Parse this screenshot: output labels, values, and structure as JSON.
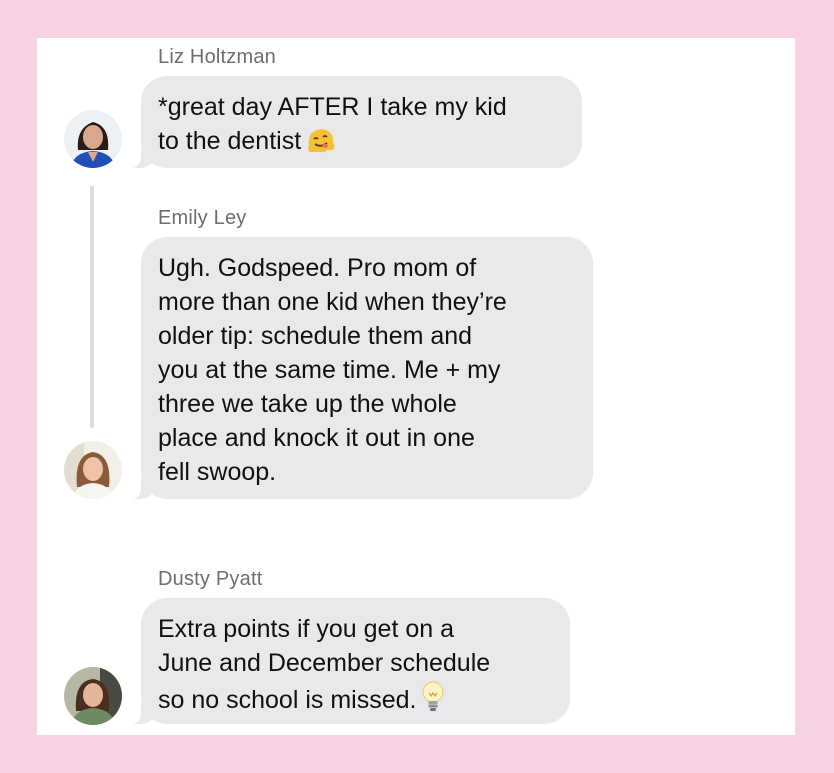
{
  "messages": [
    {
      "sender": "Liz Holtzman",
      "text": "*great day AFTER I take my kid\nto the dentist",
      "trailing_icon": "melting-face-emoji-icon",
      "avatar": "avatar-liz-holtzman"
    },
    {
      "sender": "Emily Ley",
      "text": "Ugh. Godspeed. Pro mom of\nmore than one kid when they’re\nolder tip: schedule them and\nyou at the same time. Me + my\nthree we take up the whole\nplace and knock it out in one\nfell swoop.",
      "avatar": "avatar-emily-ley"
    },
    {
      "sender": "Dusty Pyatt",
      "text": "Extra points if you get on a\nJune and December schedule\nso no school is missed.",
      "trailing_icon": "light-bulb-emoji-icon",
      "avatar": "avatar-dusty-pyatt"
    }
  ],
  "colors": {
    "page_background": "#f8d1e3",
    "card_background": "#ffffff",
    "bubble": "#e9e9eb",
    "sender_name": "#6d6d72",
    "message_text": "#111111",
    "thread_line": "#dcdce0"
  }
}
